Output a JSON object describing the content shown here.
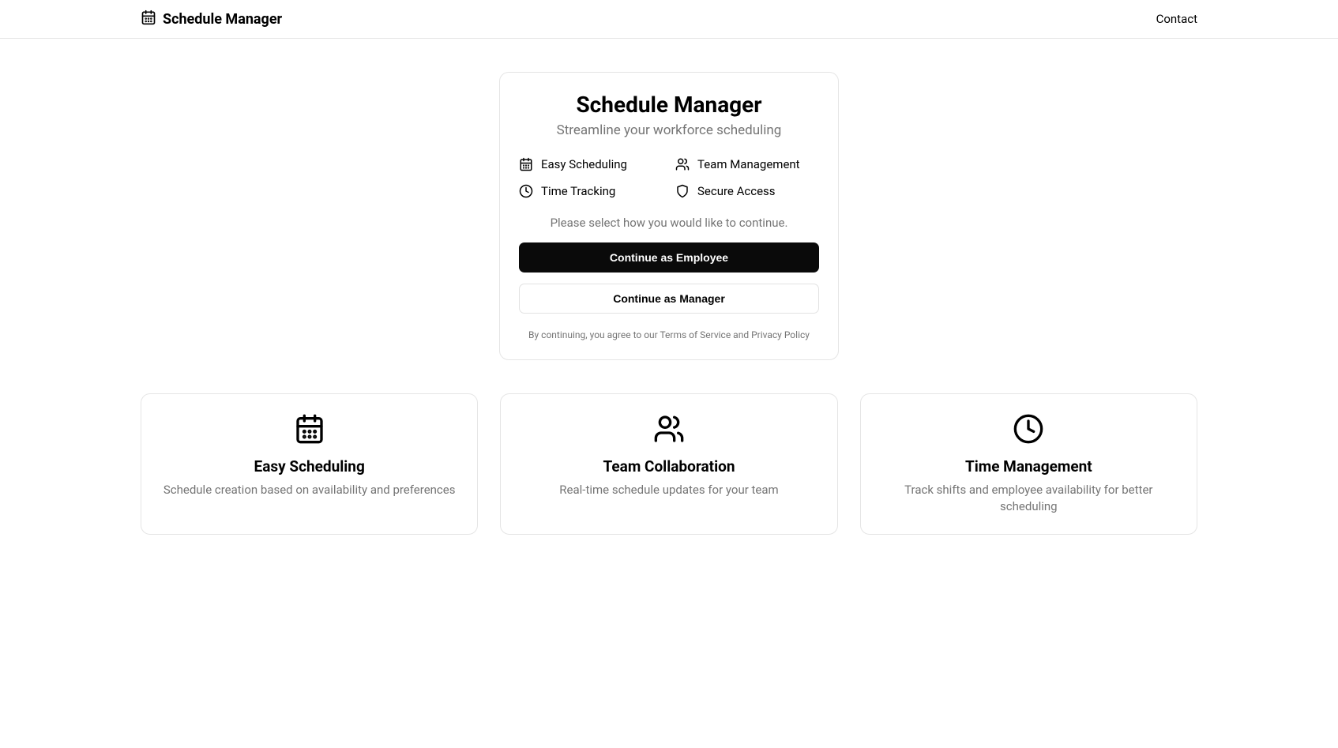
{
  "header": {
    "brand": "Schedule Manager",
    "contact": "Contact"
  },
  "card": {
    "title": "Schedule Manager",
    "subtitle": "Streamline your workforce scheduling",
    "features": [
      {
        "label": "Easy Scheduling"
      },
      {
        "label": "Team Management"
      },
      {
        "label": "Time Tracking"
      },
      {
        "label": "Secure Access"
      }
    ],
    "prompt": "Please select how you would like to continue.",
    "employee_btn": "Continue as Employee",
    "manager_btn": "Continue as Manager",
    "terms": "By continuing, you agree to our Terms of Service and Privacy Policy"
  },
  "info_cards": [
    {
      "title": "Easy Scheduling",
      "desc": "Schedule creation based on availability and preferences"
    },
    {
      "title": "Team Collaboration",
      "desc": "Real-time schedule updates for your team"
    },
    {
      "title": "Time Management",
      "desc": "Track shifts and employee availability for better scheduling"
    }
  ]
}
